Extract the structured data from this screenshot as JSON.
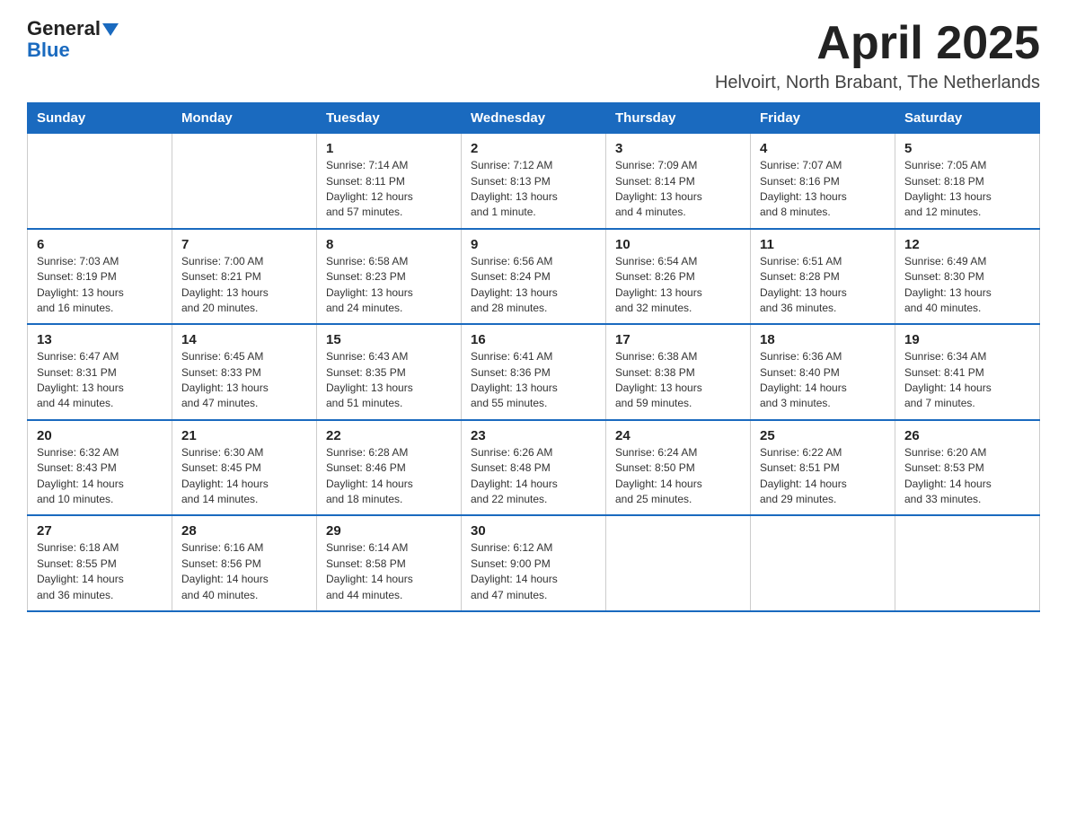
{
  "logo": {
    "general": "General",
    "blue": "Blue"
  },
  "title": "April 2025",
  "location": "Helvoirt, North Brabant, The Netherlands",
  "days_of_week": [
    "Sunday",
    "Monday",
    "Tuesday",
    "Wednesday",
    "Thursday",
    "Friday",
    "Saturday"
  ],
  "weeks": [
    [
      {
        "day": "",
        "info": ""
      },
      {
        "day": "",
        "info": ""
      },
      {
        "day": "1",
        "info": "Sunrise: 7:14 AM\nSunset: 8:11 PM\nDaylight: 12 hours\nand 57 minutes."
      },
      {
        "day": "2",
        "info": "Sunrise: 7:12 AM\nSunset: 8:13 PM\nDaylight: 13 hours\nand 1 minute."
      },
      {
        "day": "3",
        "info": "Sunrise: 7:09 AM\nSunset: 8:14 PM\nDaylight: 13 hours\nand 4 minutes."
      },
      {
        "day": "4",
        "info": "Sunrise: 7:07 AM\nSunset: 8:16 PM\nDaylight: 13 hours\nand 8 minutes."
      },
      {
        "day": "5",
        "info": "Sunrise: 7:05 AM\nSunset: 8:18 PM\nDaylight: 13 hours\nand 12 minutes."
      }
    ],
    [
      {
        "day": "6",
        "info": "Sunrise: 7:03 AM\nSunset: 8:19 PM\nDaylight: 13 hours\nand 16 minutes."
      },
      {
        "day": "7",
        "info": "Sunrise: 7:00 AM\nSunset: 8:21 PM\nDaylight: 13 hours\nand 20 minutes."
      },
      {
        "day": "8",
        "info": "Sunrise: 6:58 AM\nSunset: 8:23 PM\nDaylight: 13 hours\nand 24 minutes."
      },
      {
        "day": "9",
        "info": "Sunrise: 6:56 AM\nSunset: 8:24 PM\nDaylight: 13 hours\nand 28 minutes."
      },
      {
        "day": "10",
        "info": "Sunrise: 6:54 AM\nSunset: 8:26 PM\nDaylight: 13 hours\nand 32 minutes."
      },
      {
        "day": "11",
        "info": "Sunrise: 6:51 AM\nSunset: 8:28 PM\nDaylight: 13 hours\nand 36 minutes."
      },
      {
        "day": "12",
        "info": "Sunrise: 6:49 AM\nSunset: 8:30 PM\nDaylight: 13 hours\nand 40 minutes."
      }
    ],
    [
      {
        "day": "13",
        "info": "Sunrise: 6:47 AM\nSunset: 8:31 PM\nDaylight: 13 hours\nand 44 minutes."
      },
      {
        "day": "14",
        "info": "Sunrise: 6:45 AM\nSunset: 8:33 PM\nDaylight: 13 hours\nand 47 minutes."
      },
      {
        "day": "15",
        "info": "Sunrise: 6:43 AM\nSunset: 8:35 PM\nDaylight: 13 hours\nand 51 minutes."
      },
      {
        "day": "16",
        "info": "Sunrise: 6:41 AM\nSunset: 8:36 PM\nDaylight: 13 hours\nand 55 minutes."
      },
      {
        "day": "17",
        "info": "Sunrise: 6:38 AM\nSunset: 8:38 PM\nDaylight: 13 hours\nand 59 minutes."
      },
      {
        "day": "18",
        "info": "Sunrise: 6:36 AM\nSunset: 8:40 PM\nDaylight: 14 hours\nand 3 minutes."
      },
      {
        "day": "19",
        "info": "Sunrise: 6:34 AM\nSunset: 8:41 PM\nDaylight: 14 hours\nand 7 minutes."
      }
    ],
    [
      {
        "day": "20",
        "info": "Sunrise: 6:32 AM\nSunset: 8:43 PM\nDaylight: 14 hours\nand 10 minutes."
      },
      {
        "day": "21",
        "info": "Sunrise: 6:30 AM\nSunset: 8:45 PM\nDaylight: 14 hours\nand 14 minutes."
      },
      {
        "day": "22",
        "info": "Sunrise: 6:28 AM\nSunset: 8:46 PM\nDaylight: 14 hours\nand 18 minutes."
      },
      {
        "day": "23",
        "info": "Sunrise: 6:26 AM\nSunset: 8:48 PM\nDaylight: 14 hours\nand 22 minutes."
      },
      {
        "day": "24",
        "info": "Sunrise: 6:24 AM\nSunset: 8:50 PM\nDaylight: 14 hours\nand 25 minutes."
      },
      {
        "day": "25",
        "info": "Sunrise: 6:22 AM\nSunset: 8:51 PM\nDaylight: 14 hours\nand 29 minutes."
      },
      {
        "day": "26",
        "info": "Sunrise: 6:20 AM\nSunset: 8:53 PM\nDaylight: 14 hours\nand 33 minutes."
      }
    ],
    [
      {
        "day": "27",
        "info": "Sunrise: 6:18 AM\nSunset: 8:55 PM\nDaylight: 14 hours\nand 36 minutes."
      },
      {
        "day": "28",
        "info": "Sunrise: 6:16 AM\nSunset: 8:56 PM\nDaylight: 14 hours\nand 40 minutes."
      },
      {
        "day": "29",
        "info": "Sunrise: 6:14 AM\nSunset: 8:58 PM\nDaylight: 14 hours\nand 44 minutes."
      },
      {
        "day": "30",
        "info": "Sunrise: 6:12 AM\nSunset: 9:00 PM\nDaylight: 14 hours\nand 47 minutes."
      },
      {
        "day": "",
        "info": ""
      },
      {
        "day": "",
        "info": ""
      },
      {
        "day": "",
        "info": ""
      }
    ]
  ]
}
